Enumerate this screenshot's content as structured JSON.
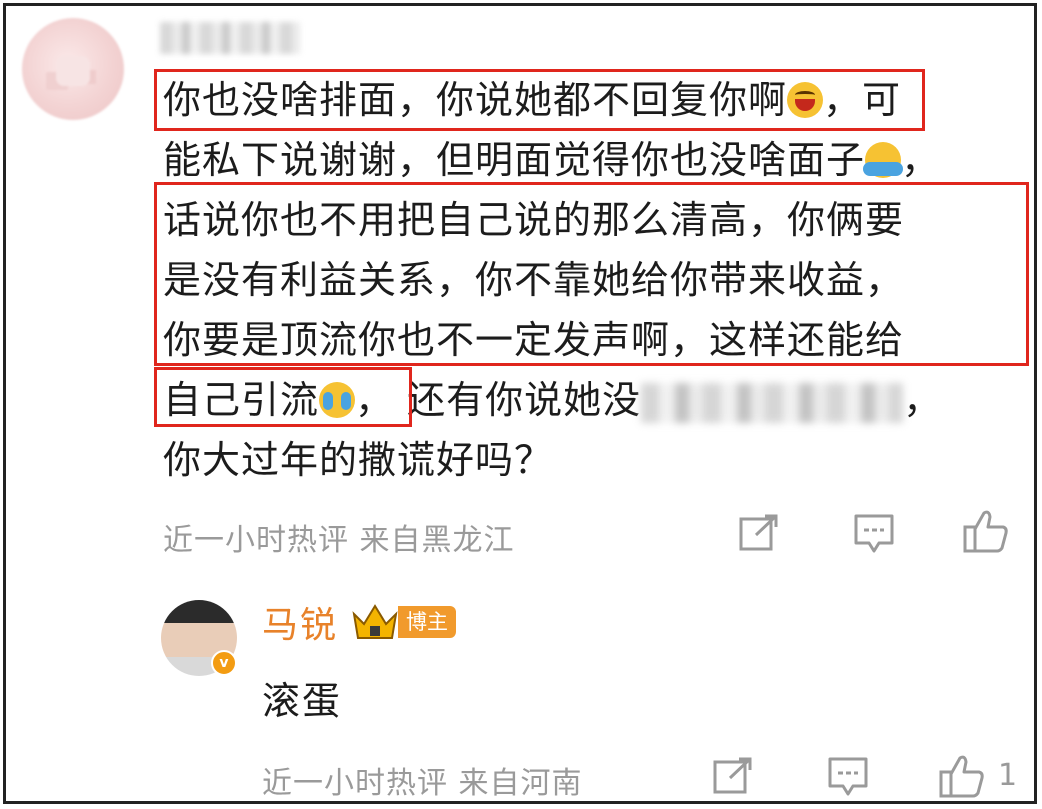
{
  "comment": {
    "lines": [
      "你也没啥排面，你说她都不回复你啊",
      "，可",
      "能私下说谢谢，但明面觉得你也没啥面子",
      "，",
      "话说你也不用把自己说的那么清高，你俩要",
      "是没有利益关系，你不靠她给你带来收益，",
      "你要是顶流你也不一定发声啊，这样还能给",
      "自己引流",
      "，",
      "还有你说她没",
      "，",
      "你大过年的撒谎好吗？"
    ],
    "emojis": [
      "laughing-emoji",
      "covering-face-emoji",
      "crying-laughing-emoji"
    ],
    "meta": "近一小时热评  来自黑龙江",
    "highlight_color": "#e0261d"
  },
  "reply": {
    "author": "马锐",
    "badge": "博主",
    "verified_mark": "v",
    "text": "滚蛋",
    "meta": "近一小时热评  来自河南",
    "like_count": "1",
    "author_color": "#e8822a"
  },
  "icons": [
    "share-icon",
    "comment-icon",
    "like-icon"
  ]
}
